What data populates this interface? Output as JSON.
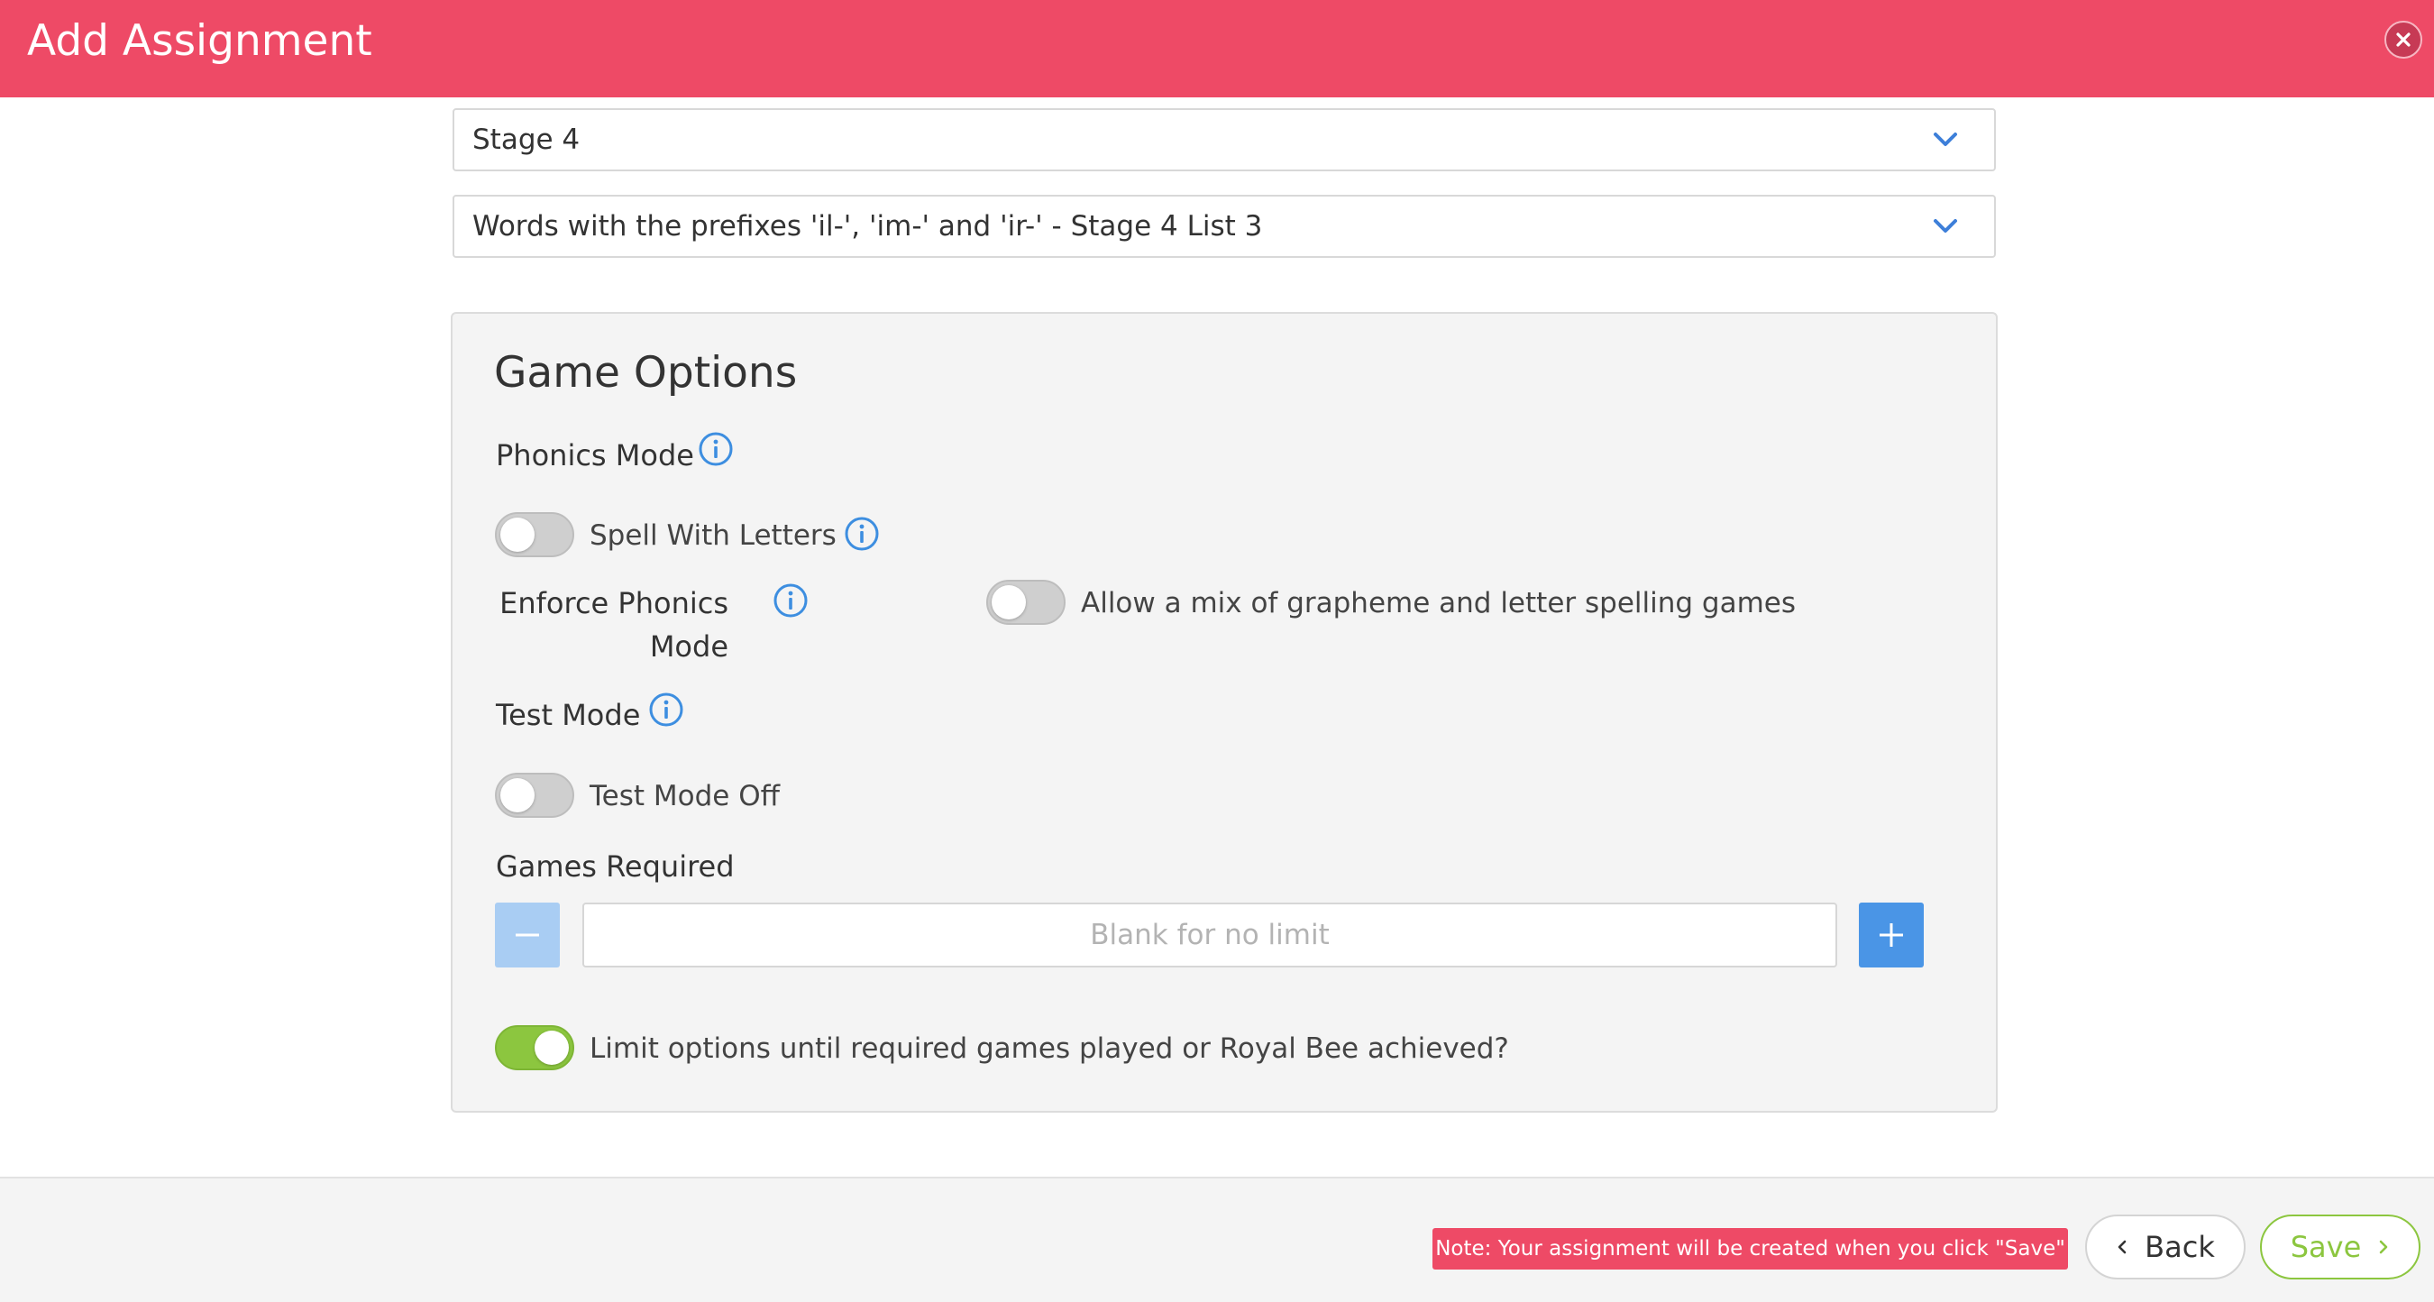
{
  "header": {
    "title": "Add Assignment",
    "close_icon": "close-icon"
  },
  "selects": {
    "stage": "Stage 4",
    "list": "Words with the prefixes 'il-', 'im-' and 'ir-' - Stage 4 List 3"
  },
  "game_options": {
    "title": "Game Options",
    "phonics_mode": {
      "label": "Phonics Mode",
      "spell_with_letters": {
        "label": "Spell With Letters",
        "on": false
      },
      "enforce_label": "Enforce Phonics Mode",
      "allow_mix": {
        "label": "Allow a mix of grapheme and letter spelling games",
        "on": false
      }
    },
    "test_mode": {
      "label": "Test Mode",
      "toggle": {
        "label": "Test Mode Off",
        "on": false
      }
    },
    "games_required": {
      "label": "Games Required",
      "placeholder": "Blank for no limit",
      "value": ""
    },
    "limit_options": {
      "label": "Limit options until required games played or Royal Bee achieved?",
      "on": true
    }
  },
  "footer": {
    "note": "Note: Your assignment will be created when you click \"Save\"",
    "back_label": "Back",
    "save_label": "Save"
  },
  "colors": {
    "brand_red": "#ee4a66",
    "accent_blue": "#4a95e6",
    "toggle_green": "#8cc63f"
  }
}
